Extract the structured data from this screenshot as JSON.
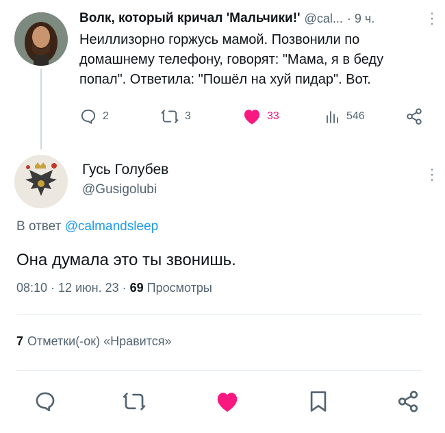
{
  "parent_tweet": {
    "author_name": "Волк, который кричал 'Мальчики!'",
    "handle": "@cal...",
    "time": "· 9 ч.",
    "text": "Неиллизорно горжусь мамой. Позвонили по домашнему телефону, говорят: \"Мама, я в беду попал\". Ответила: \"Пошёл на хуй пидар\". Вот.",
    "replies": "2",
    "retweets": "3",
    "likes": "33",
    "views": "546"
  },
  "reply_tweet": {
    "author_name": "Гусь Голубев",
    "handle": "@Gusigolubi",
    "reply_prefix": "В ответ",
    "reply_mention": "@calmandsleep",
    "text": "Она думала это ты звонишь.",
    "time": "08:10",
    "date": "12 июн. 23",
    "separator": "·",
    "views_count": "69",
    "views_label": "Просмотры",
    "likes_count": "7",
    "likes_label": "Отметки(-ок) «Нравится»"
  },
  "icons": {
    "reply": "reply-icon",
    "retweet": "retweet-icon",
    "like": "heart-icon",
    "views": "analytics-icon",
    "share": "share-icon",
    "bookmark": "bookmark-icon",
    "more": "more-vertical-icon"
  },
  "colors": {
    "like_active": "#f91880",
    "mention": "#1d9bf0",
    "secondary_text": "#536471"
  }
}
